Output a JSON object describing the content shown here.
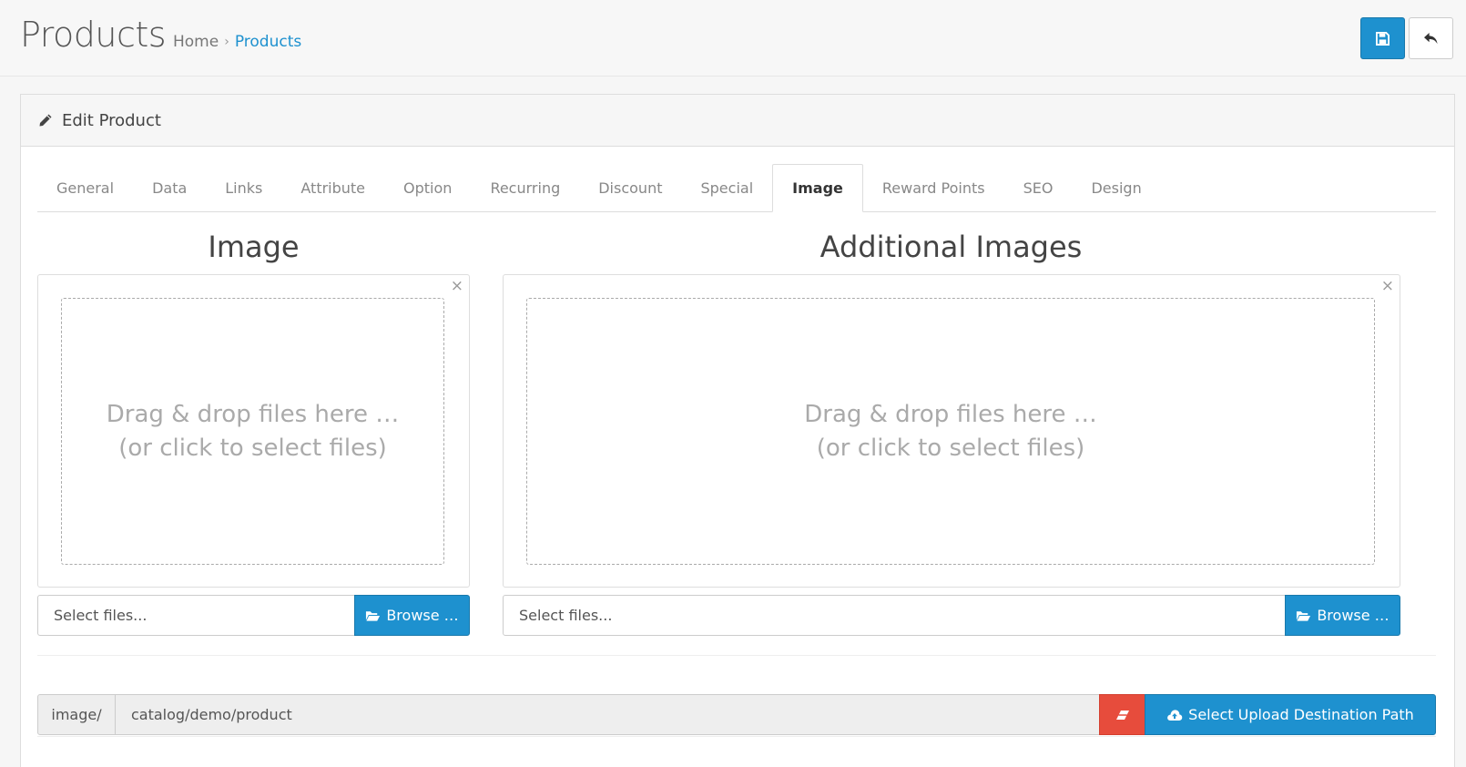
{
  "header": {
    "title": "Products",
    "breadcrumb": [
      {
        "label": "Home"
      },
      {
        "label": "Products"
      }
    ],
    "breadcrumb_separator": "›",
    "save_icon": "save-icon",
    "back_icon": "reply-icon"
  },
  "panel": {
    "title": "Edit Product",
    "title_icon": "pencil-icon"
  },
  "tabs": [
    {
      "label": "General"
    },
    {
      "label": "Data"
    },
    {
      "label": "Links"
    },
    {
      "label": "Attribute"
    },
    {
      "label": "Option"
    },
    {
      "label": "Recurring"
    },
    {
      "label": "Discount"
    },
    {
      "label": "Special"
    },
    {
      "label": "Image",
      "active": true
    },
    {
      "label": "Reward Points"
    },
    {
      "label": "SEO"
    },
    {
      "label": "Design"
    }
  ],
  "image_section": {
    "title": "Image",
    "drop_line1": "Drag & drop files here …",
    "drop_line2": "(or click to select files)",
    "close": "×",
    "file_placeholder": "Select files...",
    "browse_label": "Browse …"
  },
  "additional_section": {
    "title": "Additional Images",
    "drop_line1": "Drag & drop files here …",
    "drop_line2": "(or click to select files)",
    "close": "×",
    "file_placeholder": "Select files...",
    "browse_label": "Browse …"
  },
  "upload_path": {
    "prefix": "image/",
    "value": "catalog/demo/product",
    "clear_icon": "eraser-icon",
    "select_label": "Select Upload Destination Path",
    "select_icon": "cloud-upload-icon"
  },
  "colors": {
    "primary": "#1e91cf",
    "danger": "#e74c3c"
  }
}
